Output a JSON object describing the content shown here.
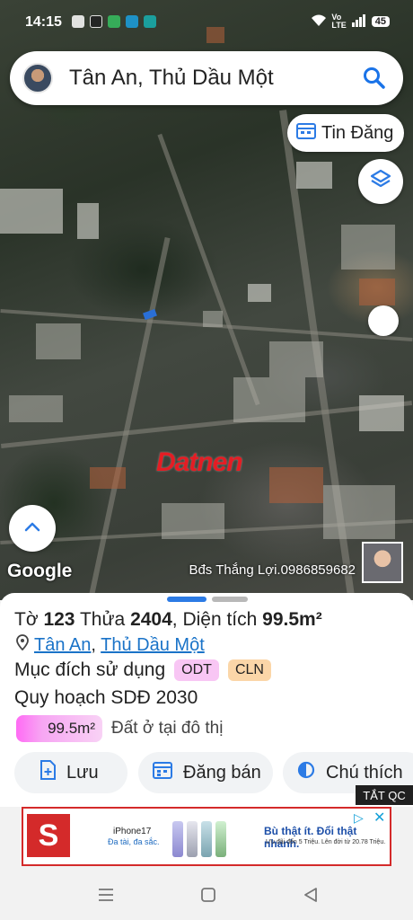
{
  "status_bar": {
    "time": "14:15",
    "battery": "45"
  },
  "search": {
    "query": "Tân An, Thủ Dầu Một"
  },
  "map": {
    "tin_dang_label": "Tin Đăng",
    "watermark": "Datnen",
    "google_logo": "Google",
    "agent_credit": "Bđs Thắng Lợi.0986859682"
  },
  "parcel": {
    "to_label": "Tờ",
    "to_value": "123",
    "thua_label": "Thửa",
    "thua_value": "2404",
    "area_label": ", Diện tích",
    "area_value": "99.5m²",
    "ward": "Tân An",
    "city": "Thủ Dầu Một",
    "location_sep": ",",
    "purpose_label": "Mục đích sử dụng",
    "purpose_tags": [
      "ODT",
      "CLN"
    ],
    "plan_label": "Quy hoạch SDĐ 2030",
    "plan_area": "99.5m²",
    "plan_desc": "Đất ở tại đô thị"
  },
  "actions": {
    "save": "Lưu",
    "post": "Đăng bán",
    "legend": "Chú thích"
  },
  "ads": {
    "hide_label": "TẮT QC",
    "logo_letter": "S",
    "phone_name": "iPhone17",
    "phone_sub": "Đa tài, đa sắc.",
    "headline": "Bù thật ít. Đổi thật nhanh.",
    "subline": "Ưu đãi đến 5 Triệu. Lên đời từ 20.78 Triệu."
  },
  "colors": {
    "accent": "#1a73c8",
    "tag_odt": "#f8c6f4",
    "tag_cln": "#fbd6a8",
    "watermark": "#e41d24"
  }
}
